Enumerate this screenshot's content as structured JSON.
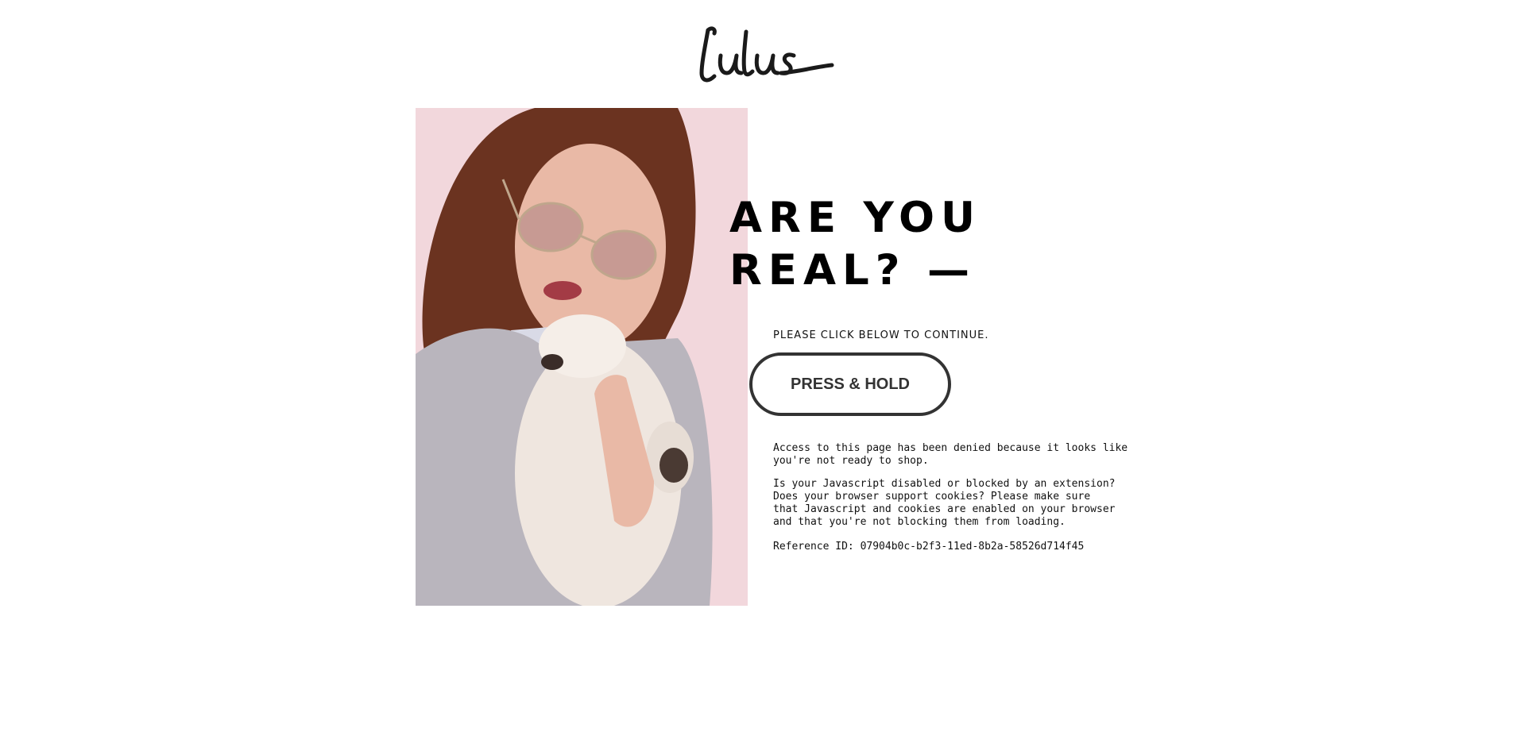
{
  "brand": {
    "logo_text": "Lulus"
  },
  "headline": {
    "line1": "ARE YOU",
    "line2": "REAL? —"
  },
  "prompt": "PLEASE CLICK BELOW TO CONTINUE.",
  "button": {
    "label": "PRESS & HOLD",
    "border_color": "#333333"
  },
  "messages": {
    "denied": [
      "Access to this page has been denied because it looks like",
      "you're not ready to shop."
    ],
    "javascript": [
      "Is your Javascript disabled or blocked by an extension?",
      "Does your browser support cookies? Please make sure",
      "that Javascript and cookies are enabled on your browser",
      "and that you're not blocking them from loading."
    ],
    "reference": "Reference ID: 07904b0c-b2f3-11ed-8b2a-58526d714f45"
  },
  "colors": {
    "background": "#ffffff",
    "hero_background": "#f2d7dc",
    "text": "#111111"
  }
}
